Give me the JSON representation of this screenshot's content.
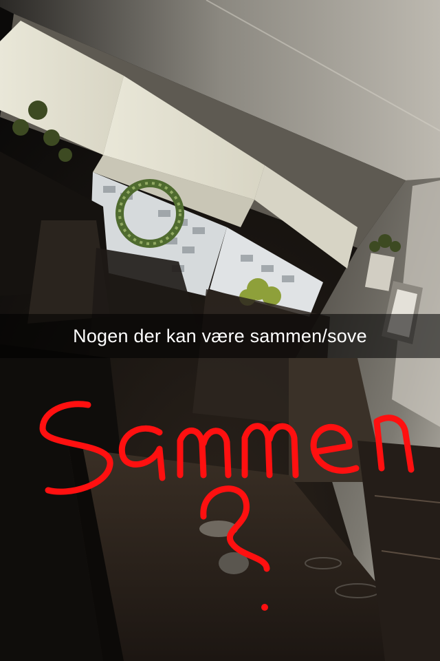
{
  "caption": {
    "text": "Nogen der kan være sammen/sove"
  },
  "drawing": {
    "color": "#ff1010",
    "handwritten_text": "Sammen?"
  },
  "colors": {
    "caption_background": "rgba(0,0,0,0.55)",
    "caption_text": "#ffffff"
  }
}
